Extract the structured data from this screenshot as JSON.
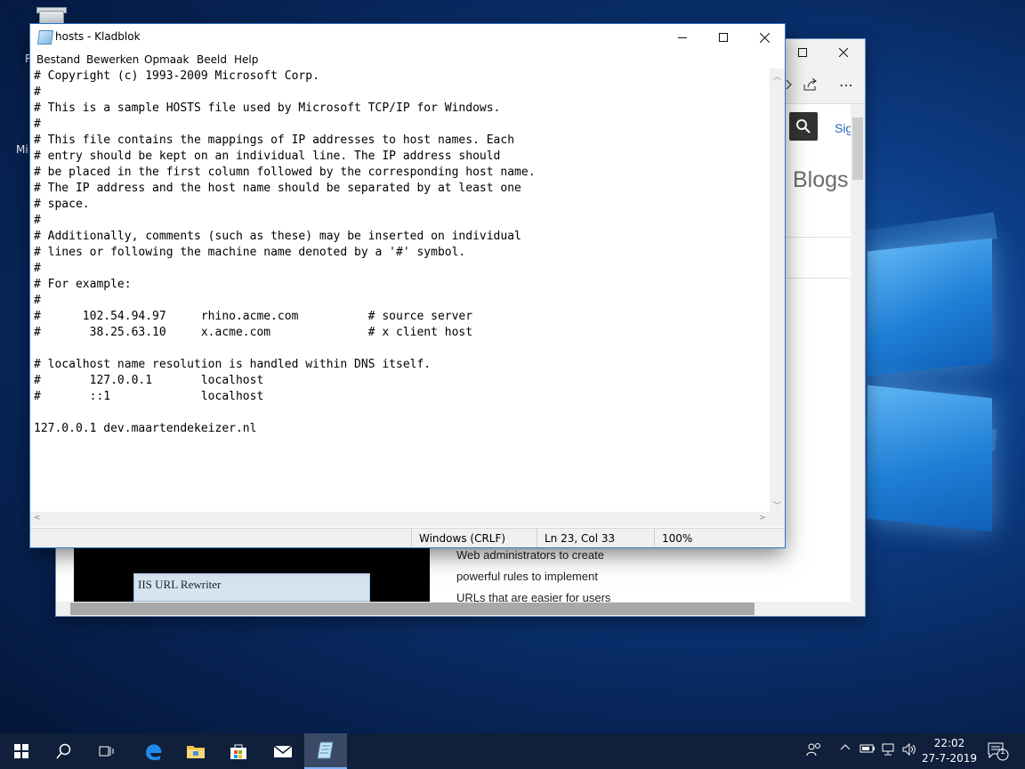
{
  "desktop": {
    "icon_label_1": "R",
    "icon_label_2": "Mi"
  },
  "edge": {
    "sign_label": "Sig",
    "blogs_label": "Blogs",
    "iis_caption": "IIS URL Rewriter",
    "article_lines": [
      "Web administrators to create",
      "powerful rules to implement",
      "URLs that are easier for users"
    ]
  },
  "notepad": {
    "title": "hosts - Kladblok",
    "menu": [
      "Bestand",
      "Bewerken",
      "Opmaak",
      "Beeld",
      "Help"
    ],
    "content": "# Copyright (c) 1993-2009 Microsoft Corp.\n#\n# This is a sample HOSTS file used by Microsoft TCP/IP for Windows.\n#\n# This file contains the mappings of IP addresses to host names. Each\n# entry should be kept on an individual line. The IP address should\n# be placed in the first column followed by the corresponding host name.\n# The IP address and the host name should be separated by at least one\n# space.\n#\n# Additionally, comments (such as these) may be inserted on individual\n# lines or following the machine name denoted by a '#' symbol.\n#\n# For example:\n#\n#      102.54.94.97     rhino.acme.com          # source server\n#       38.25.63.10     x.acme.com              # x client host\n\n# localhost name resolution is handled within DNS itself.\n#       127.0.0.1       localhost\n#       ::1             localhost\n\n127.0.0.1 dev.maartendekeizer.nl",
    "status": {
      "line_ending": "Windows (CRLF)",
      "position": "Ln 23, Col 33",
      "zoom": "100%"
    }
  },
  "taskbar": {
    "clock_time": "22:02",
    "clock_date": "27-7-2019",
    "notification_count": "1"
  }
}
